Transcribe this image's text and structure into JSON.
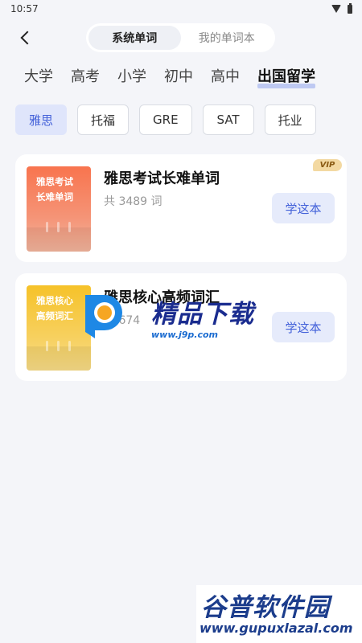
{
  "status_bar": {
    "time": "10:57"
  },
  "header": {
    "segment": {
      "tabs": [
        "系统单词",
        "我的单词本"
      ],
      "active_index": 0
    }
  },
  "level_tabs": {
    "items": [
      "大学",
      "高考",
      "小学",
      "初中",
      "高中",
      "出国留学"
    ],
    "active_index": 5
  },
  "exam_chips": {
    "items": [
      "雅思",
      "托福",
      "GRE",
      "SAT",
      "托业"
    ],
    "active_index": 0
  },
  "books": [
    {
      "cover_line1": "雅思考试",
      "cover_line2": "长难单词",
      "cover_color": "#f8744e",
      "title": "雅思考试长难单词",
      "count": "共 3489 词",
      "badge": "VIP",
      "button": "学这本"
    },
    {
      "cover_line1": "雅思核心",
      "cover_line2": "高频词汇",
      "cover_color": "#f6c229",
      "title": "雅思核心高频词汇",
      "count": "共 674",
      "button": "学这本"
    }
  ],
  "watermarks": {
    "top": {
      "text": "精品下载",
      "url": "www.j9p.com"
    },
    "bottom": {
      "text": "谷普软件园",
      "url": "www.gupuxlazal.com"
    }
  },
  "colors": {
    "accent": "#4361d9",
    "accent_bg": "#e6ebfb",
    "page_bg": "#f4f5f9"
  }
}
